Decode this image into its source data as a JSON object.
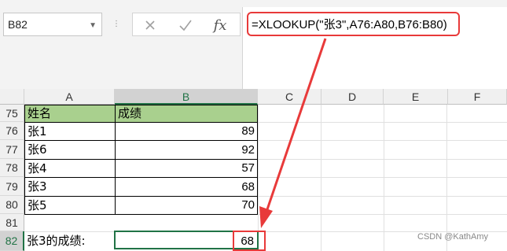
{
  "name_box": {
    "value": "B82"
  },
  "formula_bar": {
    "icons": [
      "cancel-icon",
      "enter-check-icon",
      "fx-icon"
    ],
    "fx_label": "fx",
    "formula": "=XLOOKUP(\"张3\",A76:A80,B76:B80)"
  },
  "columns": [
    "A",
    "B",
    "C",
    "D",
    "E",
    "F"
  ],
  "rows": [
    "75",
    "76",
    "77",
    "78",
    "79",
    "80",
    "81",
    "82"
  ],
  "table": {
    "headers": [
      "姓名",
      "成绩"
    ],
    "rows": [
      {
        "name": "张1",
        "score": "89"
      },
      {
        "name": "张6",
        "score": "92"
      },
      {
        "name": "张4",
        "score": "57"
      },
      {
        "name": "张3",
        "score": "68"
      },
      {
        "name": "张5",
        "score": "70"
      }
    ]
  },
  "result": {
    "label": "张3的成绩:",
    "value": "68"
  },
  "selected_cell": "B82",
  "colors": {
    "header_fill": "#a9d08e",
    "highlight": "#e83a3a",
    "select": "#217346"
  },
  "watermark": "CSDN @KathAmy"
}
